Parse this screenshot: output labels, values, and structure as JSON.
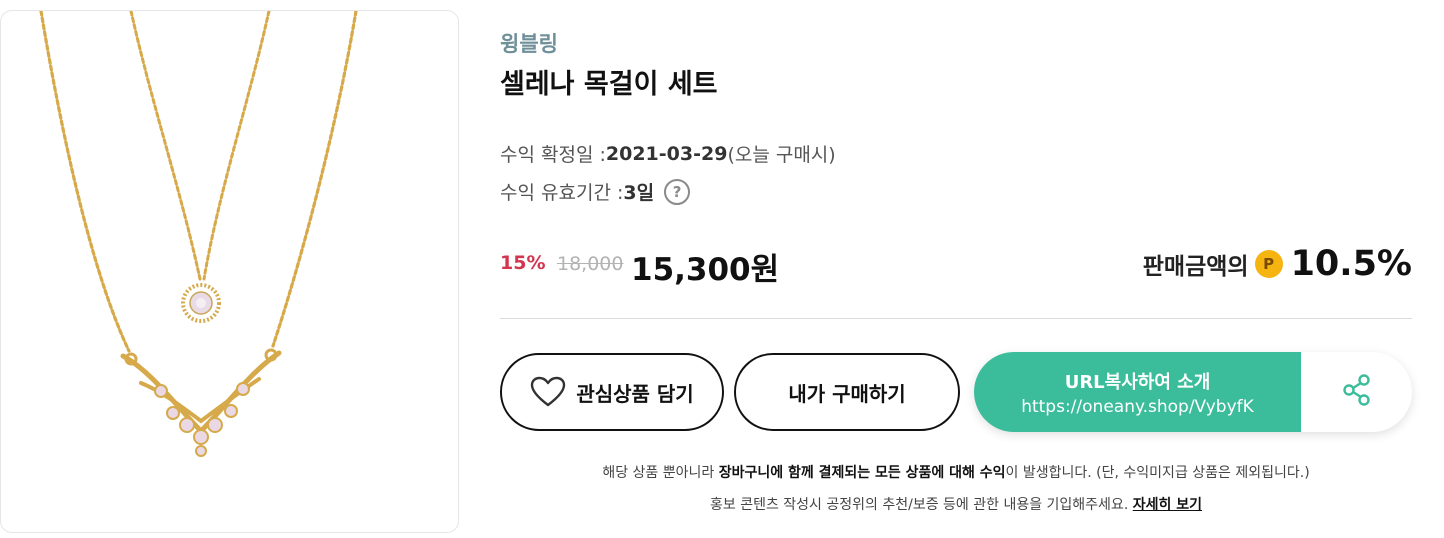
{
  "product": {
    "brand": "윙블링",
    "title": "셀레나 목걸이 세트",
    "image_alt": "necklace-set-photo"
  },
  "meta": {
    "confirm_label": "수익 확정일 : ",
    "confirm_date": "2021-03-29",
    "confirm_note": " (오늘 구매시)",
    "validity_label": "수익 유효기간 : ",
    "validity_value": "3일",
    "help_glyph": "?"
  },
  "price": {
    "discount": "15%",
    "original": "18,000",
    "sale": "15,300원"
  },
  "reward": {
    "label": "판매금액의",
    "point_glyph": "P",
    "rate": "10.5%"
  },
  "buttons": {
    "wishlist": "관심상품 담기",
    "buy": "내가 구매하기",
    "url_copy_title": "URL복사하여 소개",
    "url": "https://oneany.shop/VybyfK"
  },
  "notice": {
    "line1_a": "해당 상품 뿐아니라 ",
    "line1_b": "장바구니에 함께 결제되는 모든 상품에 대해 수익",
    "line1_c": "이 발생합니다. (단, 수익미지급 상품은 제외됩니다.)",
    "line2_a": "홍보 콘텐츠 작성시 공정위의 추천/보증 등에 관한 내용을 기입해주세요. ",
    "line2_link": "자세히 보기"
  },
  "colors": {
    "brand": "#6f8f99",
    "discount": "#d3354f",
    "accent_green": "#3bbc9b",
    "point_gold": "#f6b411",
    "gold_chain": "#d6a94a"
  },
  "icons": [
    "heart-icon",
    "share-icon",
    "help-icon",
    "point-icon"
  ]
}
